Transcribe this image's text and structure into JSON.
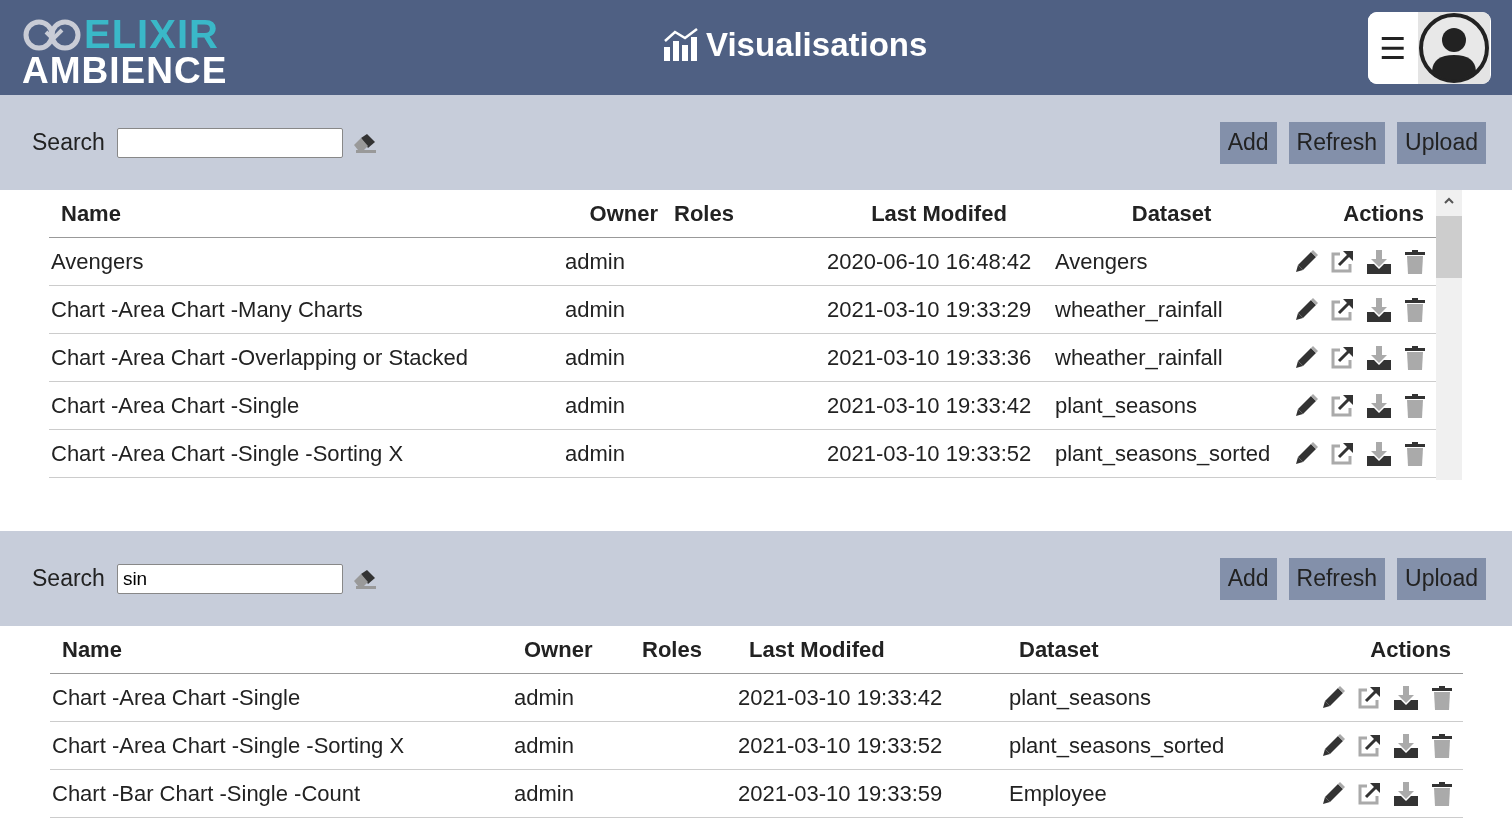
{
  "header": {
    "logo_top": "ELIXIR",
    "logo_bottom": "AMBIENCE",
    "title": "Visualisations",
    "menu_glyph": "☰"
  },
  "panels": [
    {
      "search": {
        "label": "Search"
      },
      "buttons": [
        "Add",
        "Refresh",
        "Upload"
      ],
      "scrollbar": true,
      "columns": [
        "Name",
        "Owner",
        "Roles",
        "Last Modifed",
        "Dataset",
        "Actions"
      ],
      "rows": [
        {
          "cells": [
            "Avengers",
            "admin",
            "",
            "2020-06-10 16:48:42",
            "Avengers"
          ]
        },
        {
          "cells": [
            "Chart -Area Chart -Many Charts",
            "admin",
            "",
            "2021-03-10 19:33:29",
            "wheather_rainfall"
          ]
        },
        {
          "cells": [
            "Chart -Area Chart -Overlapping or Stacked",
            "admin",
            "",
            "2021-03-10 19:33:36",
            "wheather_rainfall"
          ]
        },
        {
          "cells": [
            "Chart -Area Chart -Single",
            "admin",
            "",
            "2021-03-10 19:33:42",
            "plant_seasons"
          ]
        },
        {
          "cells": [
            "Chart -Area Chart -Single -Sorting X",
            "admin",
            "",
            "2021-03-10 19:33:52",
            "plant_seasons_sorted"
          ]
        }
      ]
    },
    {
      "search": {
        "label": "Search",
        "value": "sin"
      },
      "buttons": [
        "Add",
        "Refresh",
        "Upload"
      ],
      "scrollbar": false,
      "columns": [
        "Name",
        "Owner",
        "Roles",
        "Last Modifed",
        "Dataset",
        "Actions"
      ],
      "rows": [
        {
          "cells": [
            "Chart -Area Chart -Single",
            "admin",
            "",
            "2021-03-10 19:33:42",
            "plant_seasons"
          ]
        },
        {
          "cells": [
            "Chart -Area Chart -Single -Sorting X",
            "admin",
            "",
            "2021-03-10 19:33:52",
            "plant_seasons_sorted"
          ]
        },
        {
          "cells": [
            "Chart -Bar Chart -Single -Count",
            "admin",
            "",
            "2021-03-10 19:33:59",
            "Employee"
          ]
        }
      ]
    }
  ]
}
